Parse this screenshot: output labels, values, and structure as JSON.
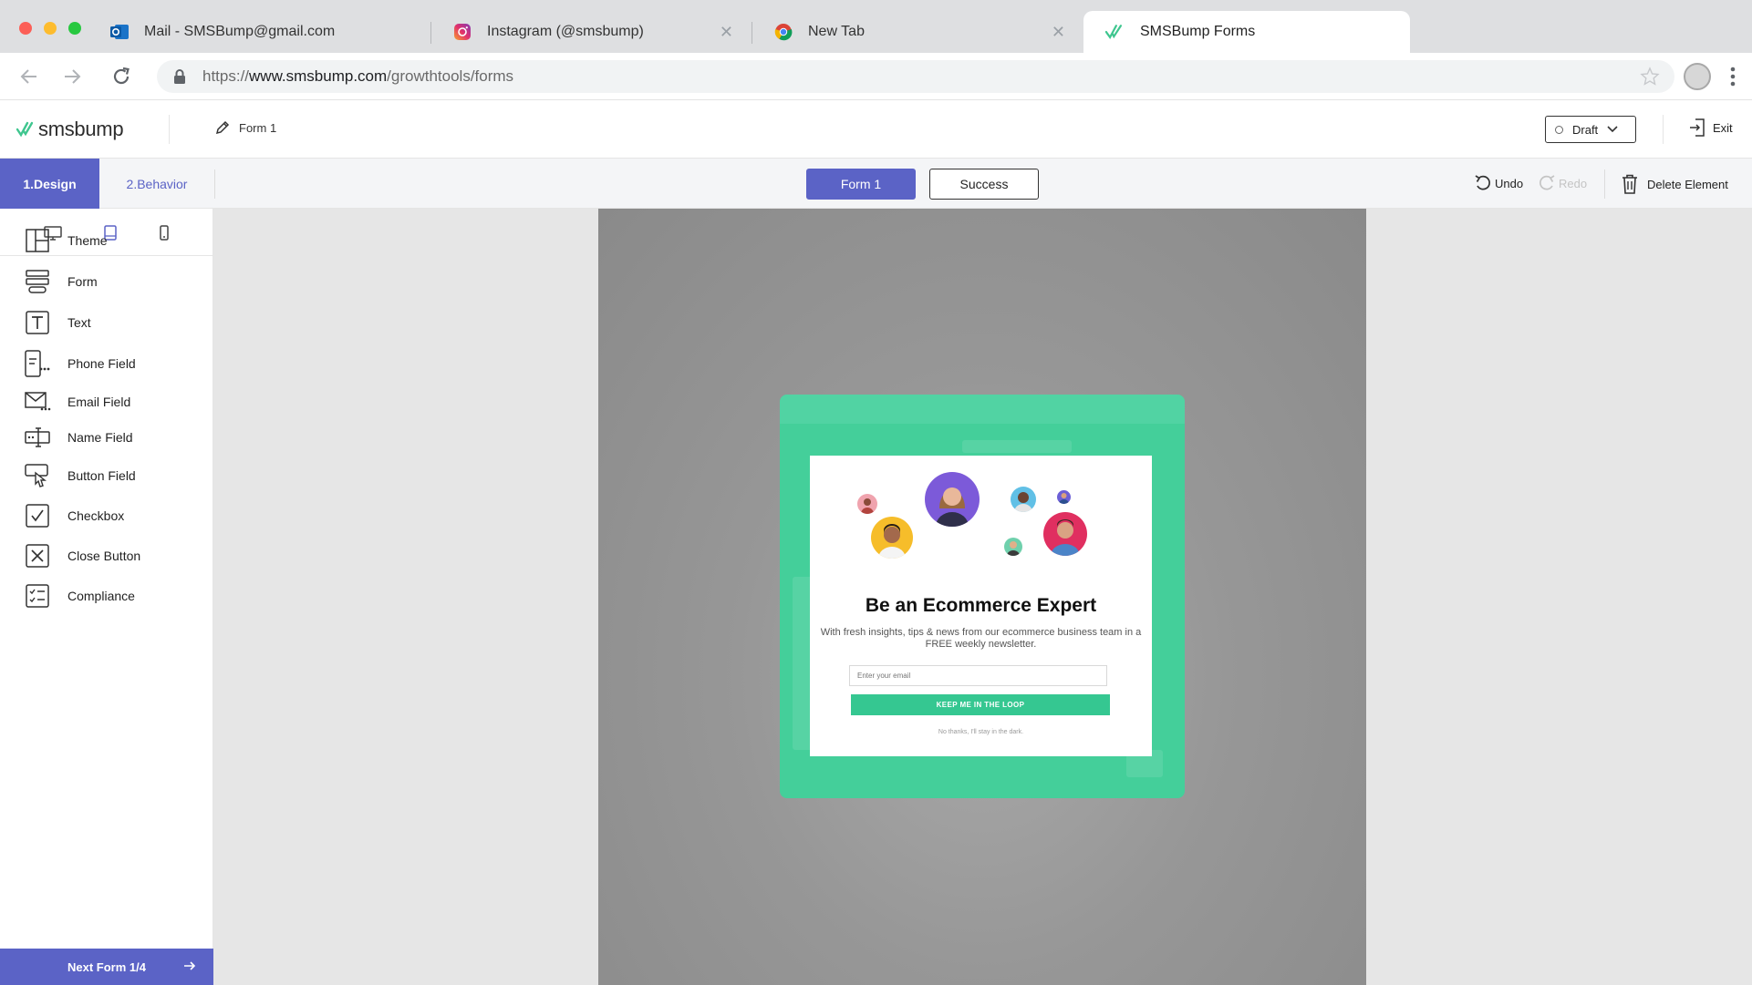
{
  "browser": {
    "tabs": [
      {
        "title": "Mail - SMSBump@gmail.com",
        "icon": "outlook-icon"
      },
      {
        "title": "Instagram (@smsbump)",
        "icon": "instagram-icon"
      },
      {
        "title": "New Tab",
        "icon": "chrome-icon"
      },
      {
        "title": "SMSBump Forms",
        "icon": "smsbump-icon"
      }
    ],
    "url_prefix": "https://",
    "url_host": "www.smsbump.com",
    "url_path": "/growthtools/forms"
  },
  "header": {
    "logo_text": "smsbump",
    "form_name": "Form 1",
    "status": "Draft",
    "exit_label": "Exit"
  },
  "toolbar": {
    "tabs": [
      {
        "label": "1.Design",
        "active": true
      },
      {
        "label": "2.Behavior",
        "active": false
      }
    ],
    "states": [
      {
        "label": "Form 1",
        "active": true
      },
      {
        "label": "Success",
        "active": false
      }
    ],
    "undo": "Undo",
    "redo": "Redo",
    "delete": "Delete Element"
  },
  "sidebar": {
    "devices": [
      "desktop-icon",
      "tablet-icon",
      "mobile-icon"
    ],
    "selected_device": "tablet-icon",
    "items": [
      {
        "label": "Theme",
        "icon": "theme-icon"
      },
      {
        "label": "Form",
        "icon": "form-icon"
      },
      {
        "label": "Text",
        "icon": "text-icon"
      },
      {
        "label": "Phone Field",
        "icon": "phone-field-icon"
      },
      {
        "label": "Email Field",
        "icon": "email-field-icon"
      },
      {
        "label": "Name Field",
        "icon": "name-field-icon"
      },
      {
        "label": "Button Field",
        "icon": "button-field-icon"
      },
      {
        "label": "Checkbox",
        "icon": "checkbox-icon"
      },
      {
        "label": "Close Button",
        "icon": "close-button-icon"
      },
      {
        "label": "Compliance",
        "icon": "compliance-icon"
      }
    ],
    "next_form": "Next Form 1/4"
  },
  "popup": {
    "headline": "Be an Ecommerce Expert",
    "subtext": "With fresh insights, tips & news from our ecommerce business team in a FREE weekly newsletter.",
    "email_placeholder": "Enter your email",
    "cta": "KEEP ME IN THE LOOP",
    "decline": "No thanks, I'll stay in the dark."
  },
  "colors": {
    "accent": "#5b63c6",
    "popup_green": "#44cf9a",
    "cta_green": "#35c791",
    "logo_green": "#3fc68f"
  }
}
